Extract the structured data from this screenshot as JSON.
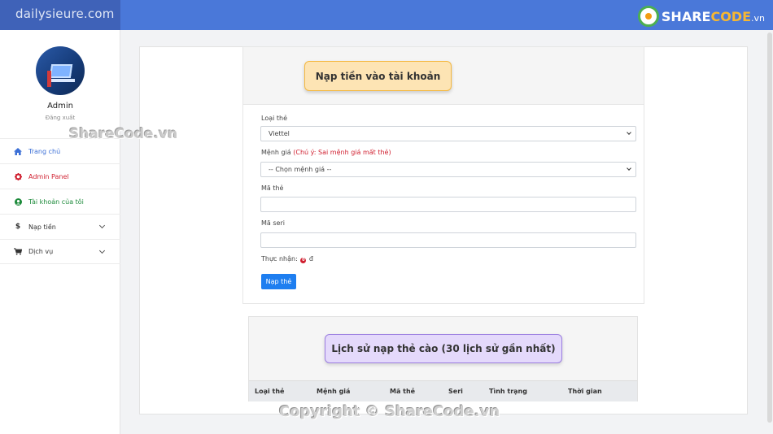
{
  "header": {
    "brand": "dailysieure.com",
    "logo": {
      "part_a": "SHARE",
      "part_b": "CODE",
      "part_c": ".vn"
    }
  },
  "sidebar": {
    "user_name": "Admin",
    "logout_label": "Đăng xuất",
    "items": [
      {
        "label": "Trang chủ",
        "icon": "home-icon",
        "color": "#3b6fd6"
      },
      {
        "label": "Admin Panel",
        "icon": "gear-icon",
        "color": "#d01f2f"
      },
      {
        "label": "Tài khoản của tôi",
        "icon": "user-circle-icon",
        "color": "#1c8a3a"
      },
      {
        "label": "Nạp tiền",
        "icon": "dollar-icon",
        "color": "#333333"
      },
      {
        "label": "Dịch vụ",
        "icon": "cart-icon",
        "color": "#333333"
      }
    ]
  },
  "watermarks": {
    "sidebar": "ShareCode.vn",
    "footer": "Copyright © ShareCode.vn"
  },
  "form": {
    "title": "Nạp tiền vào tài khoản",
    "card_type_label": "Loại thẻ",
    "card_type_value": "Viettel",
    "denomination_label": "Mệnh giá",
    "denomination_warning": "(Chú ý: Sai mệnh giá mất thẻ)",
    "denomination_value": "-- Chọn mệnh giá --",
    "card_code_label": "Mã thẻ",
    "card_code_value": "",
    "serial_label": "Mã seri",
    "serial_value": "",
    "received_label": "Thực nhận:",
    "received_amount": "0",
    "received_currency": "đ",
    "submit_label": "Nạp thẻ"
  },
  "history": {
    "title": "Lịch sử nạp thẻ cào (30 lịch sử gần nhất)",
    "columns": [
      "Loại thẻ",
      "Mệnh giá",
      "Mã thẻ",
      "Seri",
      "Tình trạng",
      "Thời gian"
    ],
    "rows": []
  },
  "colors": {
    "topbar": "#4a78d9",
    "brand_bg": "#3f62b8",
    "primary_button": "#1e7ef0",
    "warning_text": "#d01f2f"
  }
}
